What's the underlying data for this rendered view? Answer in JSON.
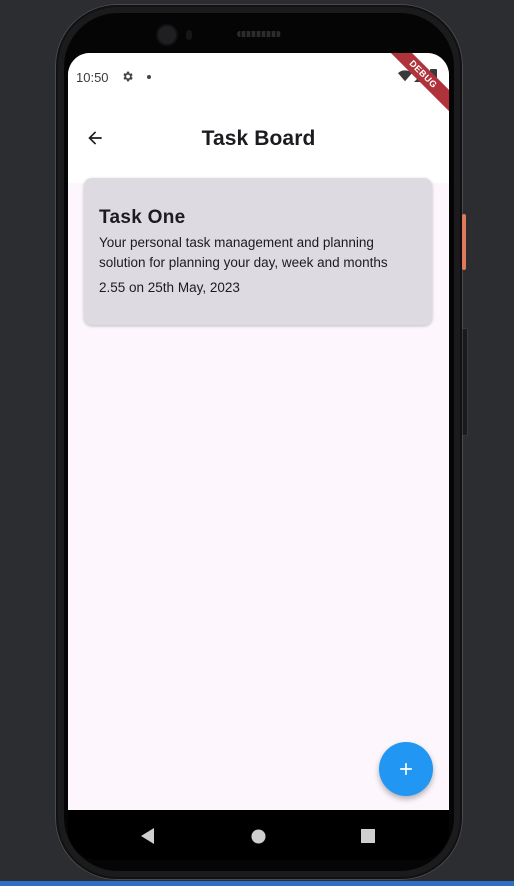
{
  "status_bar": {
    "time": "10:50",
    "icons": [
      "gear-icon",
      "dot-icon",
      "wifi-icon",
      "signal-icon",
      "battery-icon"
    ]
  },
  "debug_banner": {
    "label": "DEBUG"
  },
  "app_bar": {
    "title": "Task Board",
    "back_icon": "arrow-left-icon"
  },
  "tasks": [
    {
      "title": "Task One",
      "description": "Your personal task management and planning solution for planning your day, week and months",
      "date": "2.55 on 25th May, 2023"
    }
  ],
  "fab": {
    "icon": "plus-icon"
  },
  "nav": {
    "buttons": [
      "back-triangle-icon",
      "home-circle-icon",
      "recents-square-icon"
    ]
  },
  "colors": {
    "background": "#fdf7fd",
    "card": "#dedae2",
    "fab": "#2196f3",
    "banner": "#b0323a",
    "phone_button": "#e0785c"
  }
}
